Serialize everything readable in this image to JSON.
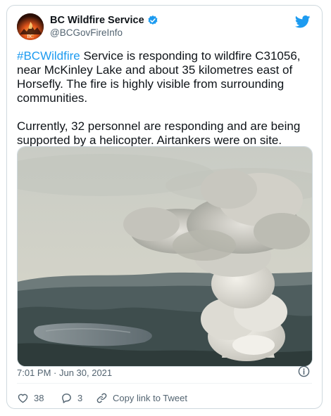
{
  "author": {
    "display_name": "BC Wildfire Service",
    "handle": "@BCGovFireInfo",
    "avatar_label": "BC",
    "verified": true
  },
  "tweet": {
    "paragraph1": {
      "hashtag": "#BCWildfire",
      "text": " Service is responding to wildfire C31056, near McKinley Lake and about 35 kilometres east of Horsefly. The fire is highly visible from surrounding communities."
    },
    "paragraph2": "Currently, 32 personnel are responding and are being supported by a helicopter. Airtankers were on site.",
    "media_icon": "wildfire-smoke-plume-photo",
    "timestamp": "7:01 PM · Jun 30, 2021"
  },
  "actions": {
    "likes": "38",
    "replies": "3",
    "copy_link_label": "Copy link to Tweet"
  },
  "icons": {
    "brand": "twitter-bird-icon",
    "verified": "verified-badge-icon",
    "info": "info-icon",
    "like": "heart-icon",
    "reply": "reply-bubble-icon",
    "link": "link-icon"
  },
  "colors": {
    "accent": "#1d9bf0",
    "like": "#f91880",
    "text": "#0f1419",
    "secondary": "#536471",
    "border": "#cfd9de"
  }
}
